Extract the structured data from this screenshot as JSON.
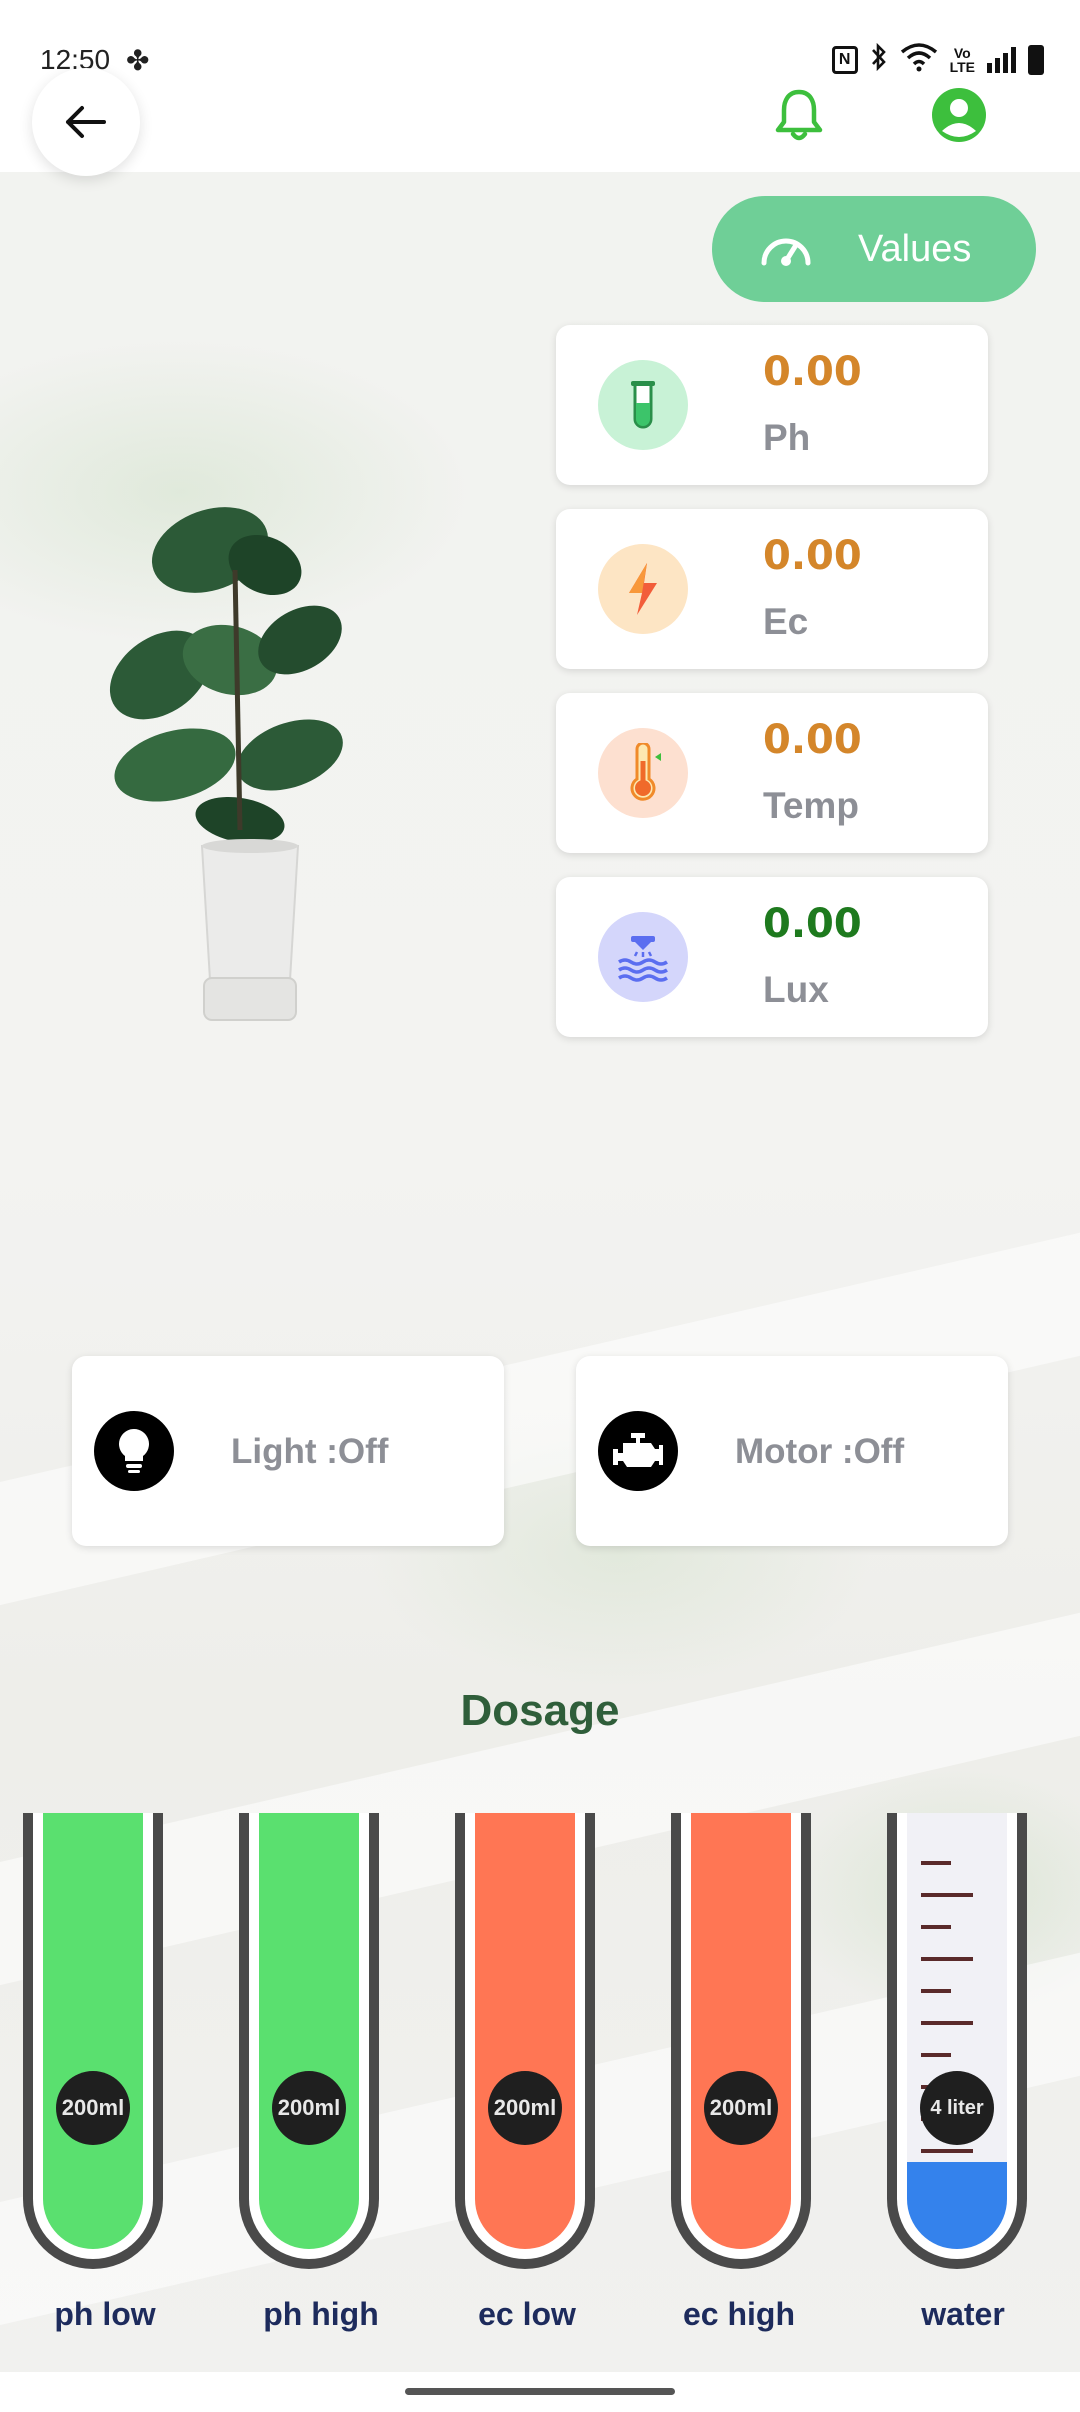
{
  "status_bar": {
    "time": "12:50",
    "icons": [
      "fan-icon",
      "nfc-icon",
      "bluetooth-icon",
      "wifi-icon",
      "volte-icon",
      "signal-icon",
      "battery-icon"
    ],
    "volte_line1": "Vo",
    "volte_line2": "LTE",
    "nfc_glyph": "N"
  },
  "header": {
    "back_icon": "arrow-left-icon",
    "notification_icon": "bell-icon",
    "profile_icon": "account-icon",
    "accent_color": "#3dbf3d"
  },
  "values_button": {
    "label": "Values",
    "icon": "speedometer-icon",
    "color": "#6fcf97"
  },
  "metrics": [
    {
      "value": "0.00",
      "label": "Ph",
      "icon": "test-tube-icon",
      "value_color": "#d4862a"
    },
    {
      "value": "0.00",
      "label": "Ec",
      "icon": "lightning-icon",
      "value_color": "#d4862a"
    },
    {
      "value": "0.00",
      "label": "Temp",
      "icon": "thermometer-icon",
      "value_color": "#d4862a"
    },
    {
      "value": "0.00",
      "label": "Lux",
      "icon": "water-waves-icon",
      "value_color": "#1e7a1e"
    }
  ],
  "devices": [
    {
      "label": "Light :Off",
      "icon": "lightbulb-icon"
    },
    {
      "label": "Motor :Off",
      "icon": "engine-icon"
    }
  ],
  "dosage": {
    "title": "Dosage",
    "tubes": [
      {
        "label": "ph low",
        "amount_line1": "200",
        "amount_line2": "ml",
        "color": "#5ae06f",
        "fill": 1.0
      },
      {
        "label": "ph high",
        "amount_line1": "200",
        "amount_line2": "ml",
        "color": "#5ae06f",
        "fill": 1.0
      },
      {
        "label": "ec low",
        "amount_line1": "200",
        "amount_line2": "ml",
        "color": "#ff7654",
        "fill": 1.0
      },
      {
        "label": "ec high",
        "amount_line1": "200",
        "amount_line2": "ml",
        "color": "#ff7654",
        "fill": 1.0
      },
      {
        "label": "water",
        "amount_line1": "4 liter",
        "amount_line2": "",
        "color": "#3482ec",
        "fill": 0.2
      }
    ]
  }
}
